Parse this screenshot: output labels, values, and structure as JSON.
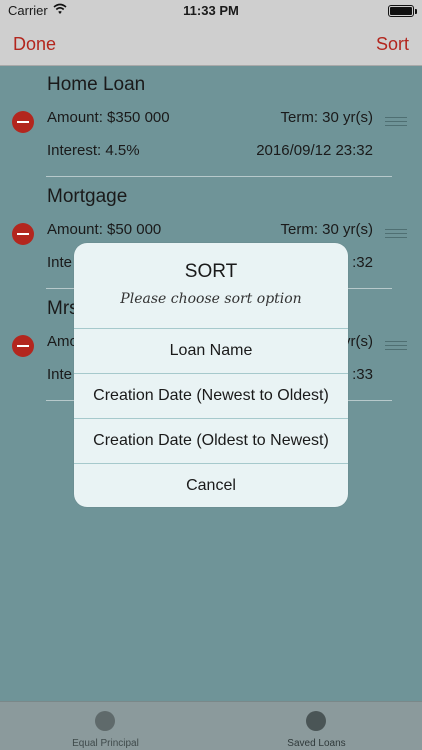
{
  "status_bar": {
    "carrier": "Carrier",
    "time": "11:33 PM"
  },
  "nav": {
    "done_label": "Done",
    "sort_label": "Sort"
  },
  "loans": [
    {
      "name": "Home Loan",
      "amount": "Amount: $350 000",
      "term": "Term: 30 yr(s)",
      "interest": "Interest: 4.5%",
      "date": "2016/09/12 23:32"
    },
    {
      "name": "Mortgage",
      "amount": "Amount: $50 000",
      "term": "Term: 30 yr(s)",
      "interest": "Inte",
      "date": ":32"
    },
    {
      "name": "Mrs",
      "amount": "Amo",
      "term": "yr(s)",
      "interest": "Inte",
      "date": ":33"
    }
  ],
  "alert": {
    "title": "SORT",
    "message": "Please choose sort option",
    "options": [
      "Loan Name",
      "Creation Date (Newest to Oldest)",
      "Creation Date (Oldest to Newest)",
      "Cancel"
    ]
  },
  "tabbar": {
    "tabs": [
      {
        "label": "Equal Principal",
        "icon": "circle-icon"
      },
      {
        "label": "Saved Loans",
        "icon": "circle-icon"
      }
    ]
  },
  "colors": {
    "accent": "#b3261e",
    "background": "#6f9498",
    "alert_bg": "#e9f3f4"
  }
}
